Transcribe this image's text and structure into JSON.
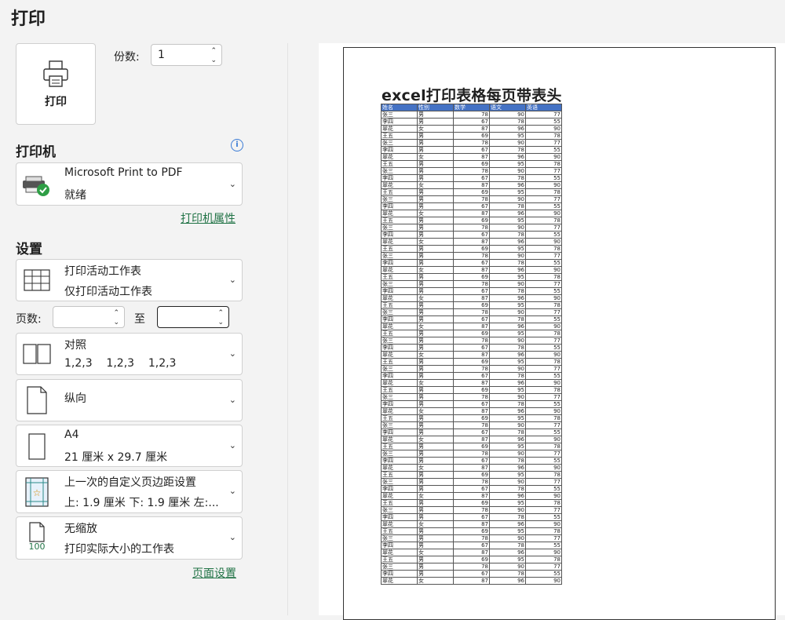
{
  "title": "打印",
  "print_button_label": "打印",
  "copies": {
    "label": "份数:",
    "value": "1"
  },
  "printer": {
    "heading": "打印机",
    "name": "Microsoft Print to PDF",
    "status": "就绪",
    "properties_link": "打印机属性"
  },
  "settings": {
    "heading": "设置",
    "scope": {
      "line1": "打印活动工作表",
      "line2": "仅打印活动工作表"
    },
    "pages_label": "页数:",
    "to_label": "至",
    "collate": {
      "line1": "对照",
      "line2": "1,2,3    1,2,3    1,2,3"
    },
    "orientation": {
      "line1": "纵向"
    },
    "paper": {
      "line1": "A4",
      "line2": "21 厘米 x 29.7 厘米"
    },
    "margins": {
      "line1": "上一次的自定义页边距设置",
      "line2": "上: 1.9 厘米 下: 1.9 厘米 左:..."
    },
    "scaling": {
      "line1": "无缩放",
      "line2": "打印实际大小的工作表",
      "icon_text": "100"
    },
    "page_setup_link": "页面设置"
  },
  "preview": {
    "sheet_title": "excel打印表格每页带表头",
    "headers": [
      "姓名",
      "性别",
      "数学",
      "语文",
      "英语"
    ],
    "rows": [
      [
        "张三",
        "男",
        "78",
        "90",
        "77"
      ],
      [
        "李四",
        "男",
        "67",
        "78",
        "55"
      ],
      [
        "翠花",
        "女",
        "87",
        "96",
        "90"
      ],
      [
        "王五",
        "男",
        "69",
        "95",
        "78"
      ],
      [
        "张三",
        "男",
        "78",
        "90",
        "77"
      ],
      [
        "李四",
        "男",
        "67",
        "78",
        "55"
      ],
      [
        "翠花",
        "女",
        "87",
        "96",
        "90"
      ],
      [
        "王五",
        "男",
        "69",
        "95",
        "78"
      ],
      [
        "张三",
        "男",
        "78",
        "90",
        "77"
      ],
      [
        "李四",
        "男",
        "67",
        "78",
        "55"
      ],
      [
        "翠花",
        "女",
        "87",
        "96",
        "90"
      ],
      [
        "王五",
        "男",
        "69",
        "95",
        "78"
      ],
      [
        "张三",
        "男",
        "78",
        "90",
        "77"
      ],
      [
        "李四",
        "男",
        "67",
        "78",
        "55"
      ],
      [
        "翠花",
        "女",
        "87",
        "96",
        "90"
      ],
      [
        "王五",
        "男",
        "69",
        "95",
        "78"
      ],
      [
        "张三",
        "男",
        "78",
        "90",
        "77"
      ],
      [
        "李四",
        "男",
        "67",
        "78",
        "55"
      ],
      [
        "翠花",
        "女",
        "87",
        "96",
        "90"
      ],
      [
        "王五",
        "男",
        "69",
        "95",
        "78"
      ],
      [
        "张三",
        "男",
        "78",
        "90",
        "77"
      ],
      [
        "李四",
        "男",
        "67",
        "78",
        "55"
      ],
      [
        "翠花",
        "女",
        "87",
        "96",
        "90"
      ],
      [
        "王五",
        "男",
        "69",
        "95",
        "78"
      ],
      [
        "张三",
        "男",
        "78",
        "90",
        "77"
      ],
      [
        "李四",
        "男",
        "67",
        "78",
        "55"
      ],
      [
        "翠花",
        "女",
        "87",
        "96",
        "90"
      ],
      [
        "王五",
        "男",
        "69",
        "95",
        "78"
      ],
      [
        "张三",
        "男",
        "78",
        "90",
        "77"
      ],
      [
        "李四",
        "男",
        "67",
        "78",
        "55"
      ],
      [
        "翠花",
        "女",
        "87",
        "96",
        "90"
      ],
      [
        "王五",
        "男",
        "69",
        "95",
        "78"
      ],
      [
        "张三",
        "男",
        "78",
        "90",
        "77"
      ],
      [
        "李四",
        "男",
        "67",
        "78",
        "55"
      ],
      [
        "翠花",
        "女",
        "87",
        "96",
        "90"
      ],
      [
        "王五",
        "男",
        "69",
        "95",
        "78"
      ],
      [
        "张三",
        "男",
        "78",
        "90",
        "77"
      ],
      [
        "李四",
        "男",
        "67",
        "78",
        "55"
      ],
      [
        "翠花",
        "女",
        "87",
        "96",
        "90"
      ],
      [
        "王五",
        "男",
        "69",
        "95",
        "78"
      ],
      [
        "张三",
        "男",
        "78",
        "90",
        "77"
      ],
      [
        "李四",
        "男",
        "67",
        "78",
        "55"
      ],
      [
        "翠花",
        "女",
        "87",
        "96",
        "90"
      ],
      [
        "王五",
        "男",
        "69",
        "95",
        "78"
      ],
      [
        "张三",
        "男",
        "78",
        "90",
        "77"
      ],
      [
        "李四",
        "男",
        "67",
        "78",
        "55"
      ],
      [
        "翠花",
        "女",
        "87",
        "96",
        "90"
      ],
      [
        "王五",
        "男",
        "69",
        "95",
        "78"
      ],
      [
        "张三",
        "男",
        "78",
        "90",
        "77"
      ],
      [
        "李四",
        "男",
        "67",
        "78",
        "55"
      ],
      [
        "翠花",
        "女",
        "87",
        "96",
        "90"
      ],
      [
        "王五",
        "男",
        "69",
        "95",
        "78"
      ],
      [
        "张三",
        "男",
        "78",
        "90",
        "77"
      ],
      [
        "李四",
        "男",
        "67",
        "78",
        "55"
      ],
      [
        "翠花",
        "女",
        "87",
        "96",
        "90"
      ],
      [
        "王五",
        "男",
        "69",
        "95",
        "78"
      ],
      [
        "张三",
        "男",
        "78",
        "90",
        "77"
      ],
      [
        "李四",
        "男",
        "67",
        "78",
        "55"
      ],
      [
        "翠花",
        "女",
        "87",
        "96",
        "90"
      ],
      [
        "王五",
        "男",
        "69",
        "95",
        "78"
      ],
      [
        "张三",
        "男",
        "78",
        "90",
        "77"
      ],
      [
        "李四",
        "男",
        "67",
        "78",
        "55"
      ],
      [
        "翠花",
        "女",
        "87",
        "96",
        "90"
      ],
      [
        "王五",
        "男",
        "69",
        "95",
        "78"
      ],
      [
        "张三",
        "男",
        "78",
        "90",
        "77"
      ],
      [
        "李四",
        "男",
        "67",
        "78",
        "55"
      ],
      [
        "翠花",
        "女",
        "87",
        "96",
        "90"
      ]
    ]
  },
  "colors": {
    "link": "#217346",
    "header_fill": "#4472c4",
    "status_ok": "#2e9e45",
    "info": "#3a7bd5"
  }
}
